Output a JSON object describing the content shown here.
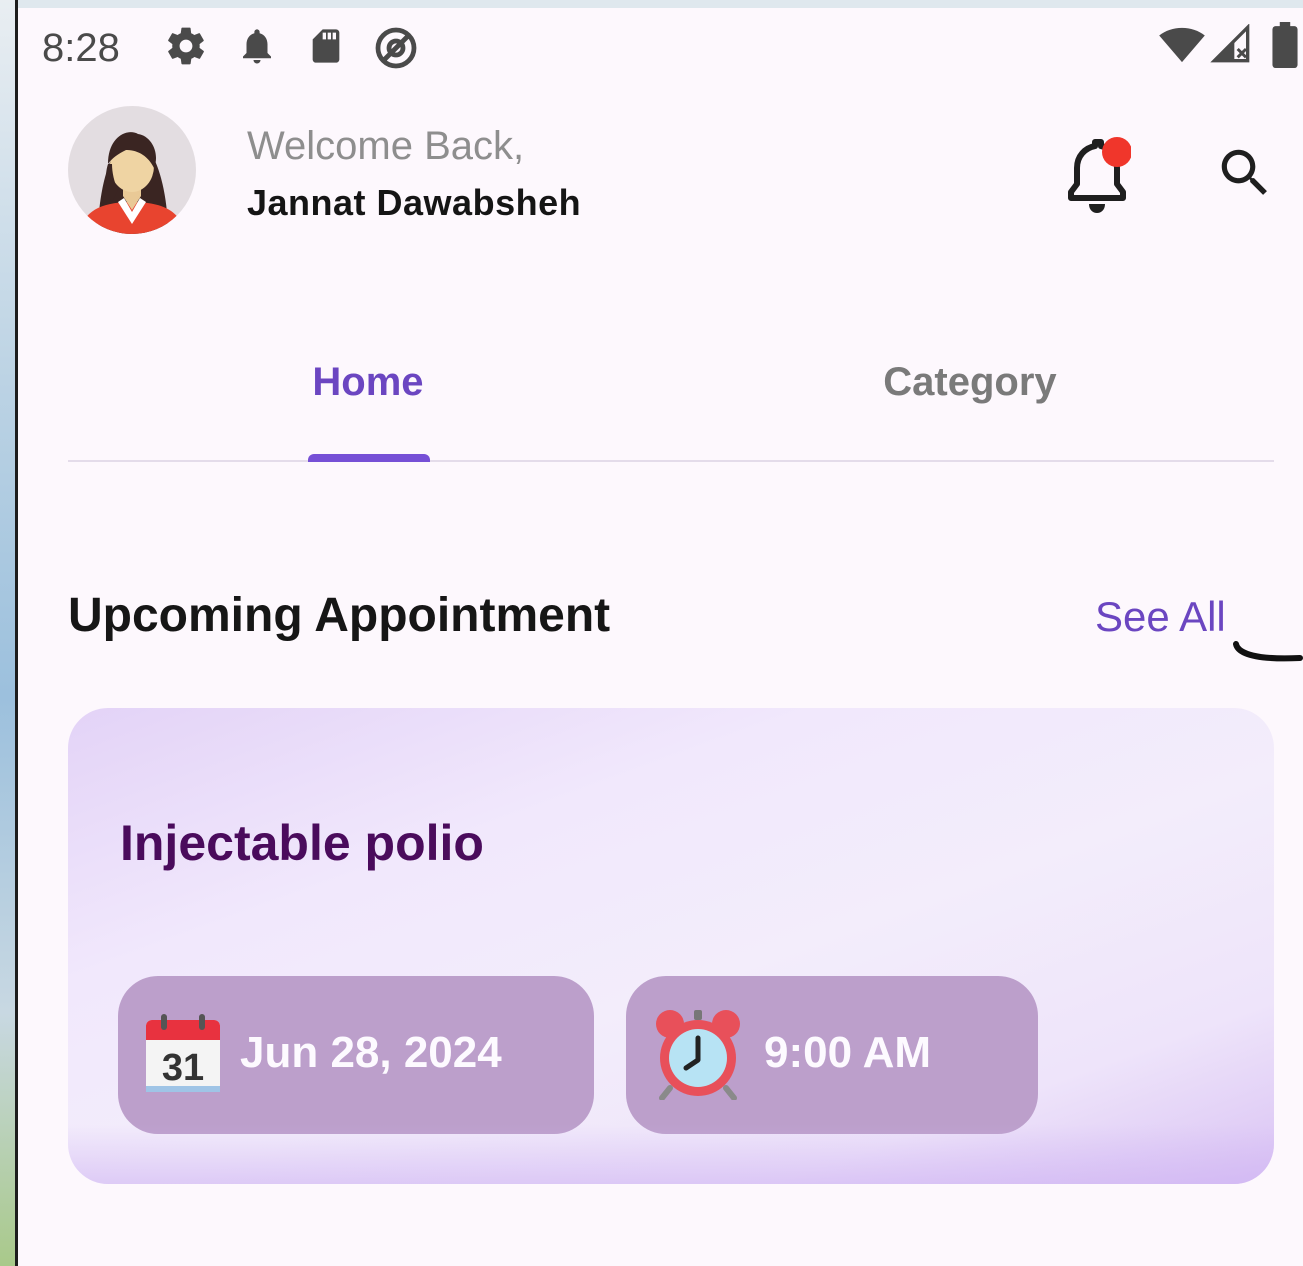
{
  "status_bar": {
    "time": "8:28",
    "left_icons": [
      "settings-icon",
      "notification-bell-icon",
      "sd-card-icon",
      "at-sign-icon"
    ],
    "right_icons": [
      "wifi-icon",
      "cell-signal-icon",
      "battery-icon"
    ]
  },
  "header": {
    "welcome_text": "Welcome Back,",
    "user_name": "Jannat Dawabsheh",
    "notification_dot_color": "#f0362b"
  },
  "tabs": [
    {
      "label": "Home",
      "active": true
    },
    {
      "label": "Category",
      "active": false
    }
  ],
  "section": {
    "title": "Upcoming Appointment",
    "see_all": "See All"
  },
  "appointment": {
    "title": "Injectable polio",
    "date": "Jun 28, 2024",
    "time": "9:00 AM",
    "calendar_day": "31"
  },
  "colors": {
    "accent": "#6b46c1",
    "card_title": "#4a0b5c",
    "chip_bg": "#bc9fcb"
  }
}
